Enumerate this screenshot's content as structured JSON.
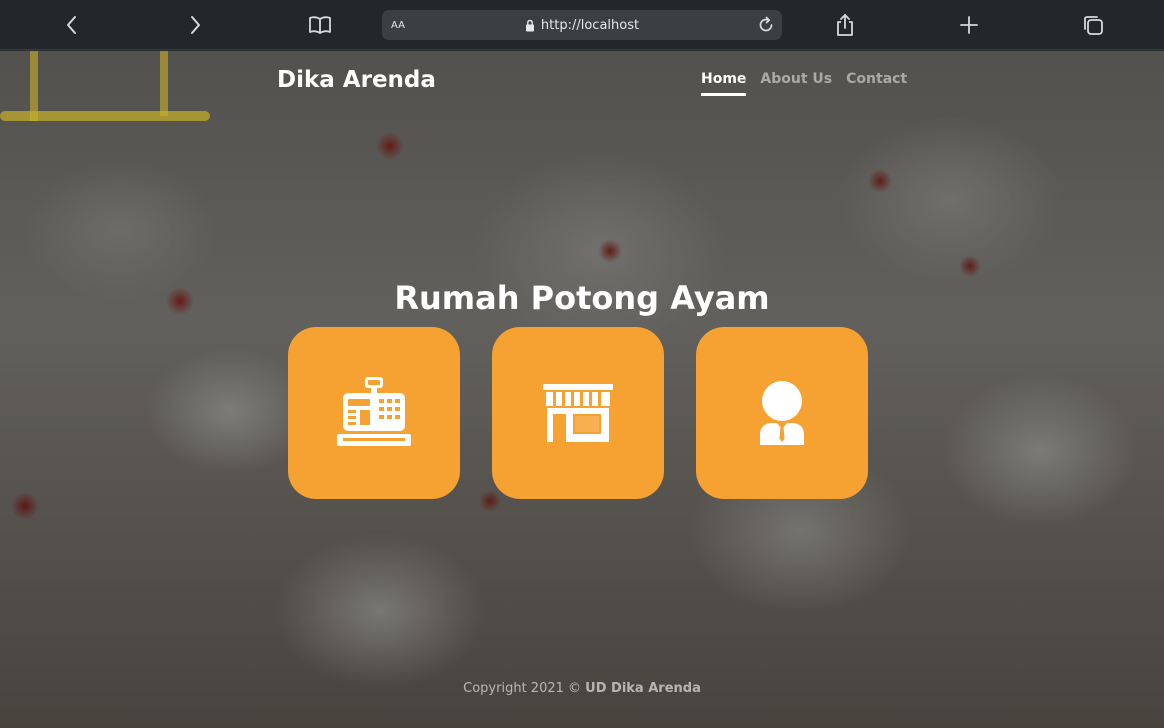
{
  "browser": {
    "text_size_label": "AA",
    "url": "http://localhost",
    "icons": [
      "back-icon",
      "forward-icon",
      "reader-icon",
      "lock-icon",
      "reload-icon",
      "share-icon",
      "new-tab-icon",
      "tabs-icon"
    ]
  },
  "site": {
    "brand": "Dika Arenda",
    "nav": [
      {
        "label": "Home",
        "active": true
      },
      {
        "label": "About Us",
        "active": false
      },
      {
        "label": "Contact",
        "active": false
      }
    ],
    "hero_title": "Rumah Potong Ayam",
    "tiles": [
      {
        "icon": "cash-register-icon"
      },
      {
        "icon": "shop-icon"
      },
      {
        "icon": "user-icon"
      }
    ],
    "footer": {
      "prefix": "Copyright 2021 ©",
      "company": "UD Dika Arenda"
    }
  },
  "colors": {
    "tile": "#f5a233",
    "browser_bar": "#23272b",
    "address_bar": "#3b3f44"
  }
}
